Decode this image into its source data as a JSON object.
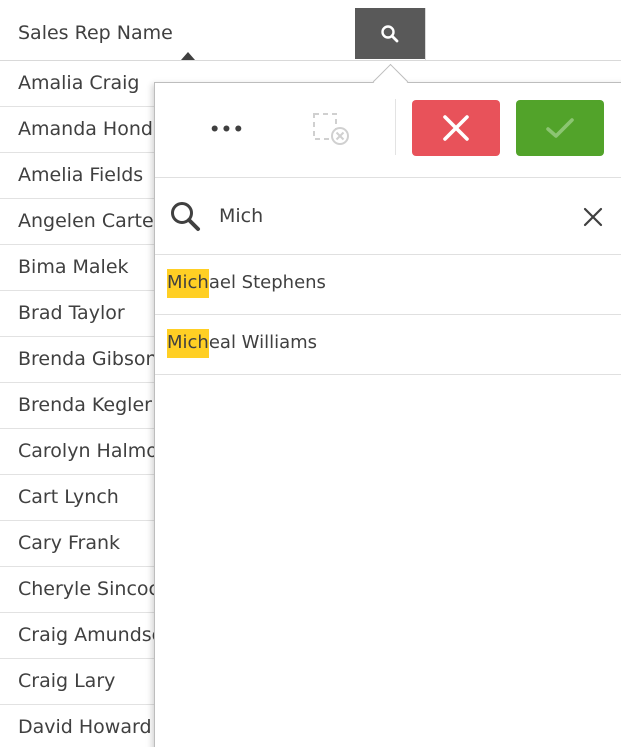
{
  "table": {
    "header_label": "Sales Rep Name",
    "rows": [
      "Amalia Craig",
      "Amanda Honda",
      "Amelia Fields",
      "Angelen Carter",
      "Bima Malek",
      "Brad Taylor",
      "Brenda Gibson",
      "Brenda Kegler",
      "Carolyn Halmon",
      "Cart Lynch",
      "Cary Frank",
      "Cheryle Sincock",
      "Craig Amundsen",
      "Craig Lary",
      "David Howard"
    ]
  },
  "popover": {
    "more_label": "•••",
    "search": {
      "value": "Mich",
      "placeholder": ""
    },
    "results": [
      {
        "match": "Mich",
        "rest": "ael Stephens"
      },
      {
        "match": "Mich",
        "rest": "eal Williams"
      }
    ]
  },
  "colors": {
    "header_search_bg": "#595959",
    "cancel": "#e8525a",
    "confirm": "#52a32a",
    "highlight": "#ffcf24",
    "text": "#404040"
  },
  "icons": {
    "header_search": "search-icon",
    "more": "more-icon",
    "clear_selections": "clear-selections-icon",
    "cancel": "close-icon",
    "confirm": "check-icon",
    "search": "search-icon",
    "search_clear": "close-icon"
  }
}
